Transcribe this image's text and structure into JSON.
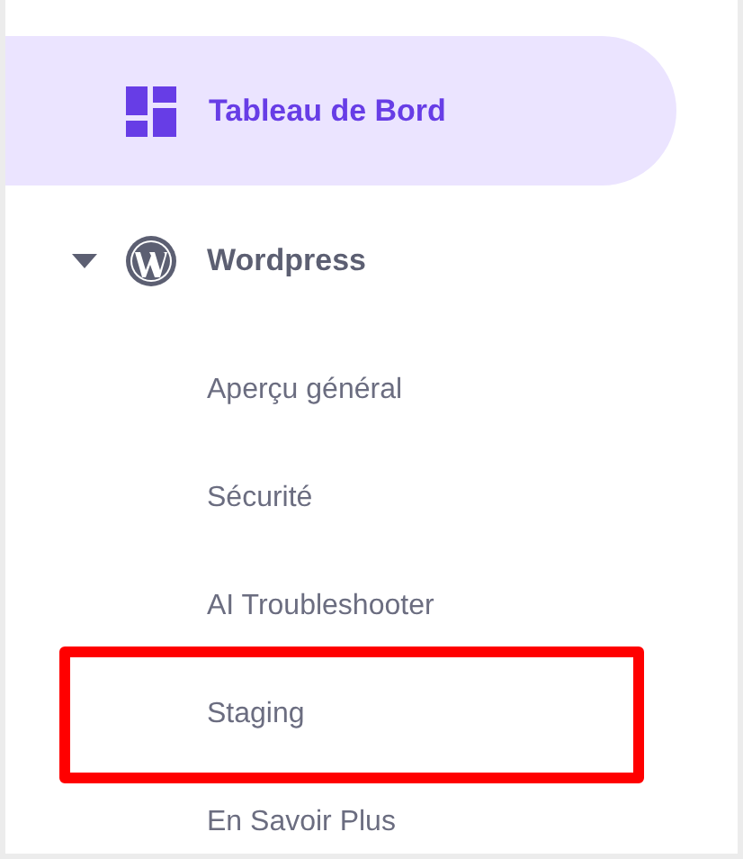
{
  "dashboard": {
    "label": "Tableau de Bord",
    "selected": true
  },
  "section": {
    "label": "Wordpress",
    "expanded": true,
    "items": [
      {
        "label": "Aperçu général",
        "highlighted": false
      },
      {
        "label": "Sécurité",
        "highlighted": false
      },
      {
        "label": "AI Troubleshooter",
        "highlighted": false
      },
      {
        "label": "Staging",
        "highlighted": true
      },
      {
        "label": "En Savoir Plus",
        "highlighted": false
      }
    ]
  }
}
